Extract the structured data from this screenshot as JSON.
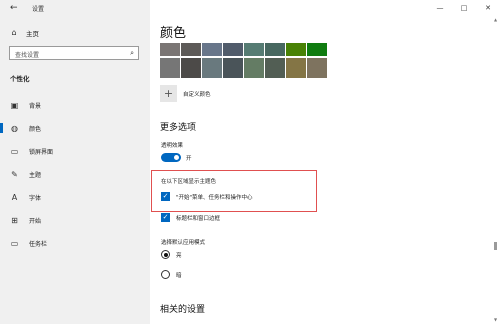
{
  "window": {
    "title": "设置",
    "minimize": "—",
    "maximize": "□",
    "close": "✕"
  },
  "sidebar": {
    "home_label": "主页",
    "search_placeholder": "查找设置",
    "section_title": "个性化",
    "items": [
      {
        "label": "背景",
        "icon": "image-icon"
      },
      {
        "label": "颜色",
        "icon": "palette-icon",
        "active": true
      },
      {
        "label": "锁屏界面",
        "icon": "lock-screen-icon"
      },
      {
        "label": "主题",
        "icon": "theme-icon"
      },
      {
        "label": "字体",
        "icon": "font-icon"
      },
      {
        "label": "开始",
        "icon": "start-icon"
      },
      {
        "label": "任务栏",
        "icon": "taskbar-icon"
      }
    ]
  },
  "main": {
    "heading": "颜色",
    "swatches_row1": [
      "#7a7574",
      "#5d5a58",
      "#68768a",
      "#515c6b",
      "#567c73",
      "#486860",
      "#498205",
      "#107c10"
    ],
    "swatches_row2": [
      "#767676",
      "#4c4a48",
      "#69797e",
      "#4a5459",
      "#647c64",
      "#525e54",
      "#847545",
      "#7e735f"
    ],
    "custom_color_label": "自定义颜色",
    "more_options_heading": "更多选项",
    "transparency_label": "透明效果",
    "transparency_state": "开",
    "show_accent_label": "在以下区域显示主题色",
    "checkbox1_label": "\"开始\"菜单、任务栏和操作中心",
    "checkbox2_label": "标题栏和窗口边框",
    "default_mode_label": "选择默认应用模式",
    "radio_light": "亮",
    "radio_dark": "暗",
    "related_heading": "相关的设置"
  },
  "colors": {
    "accent": "#0067c0",
    "highlight": "#e05050",
    "sidebar_bg": "#f0f0f0"
  }
}
